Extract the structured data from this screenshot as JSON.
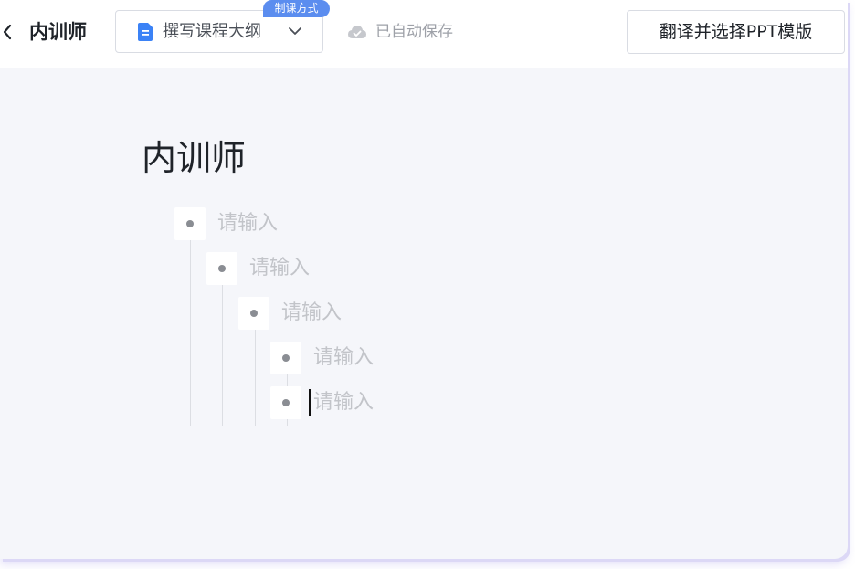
{
  "header": {
    "back_icon": "chevron-left-icon",
    "doc_name": "内训师",
    "mode_select": {
      "badge": "制课方式",
      "selected": "撰写课程大纲",
      "icon": "document-icon",
      "icon_color": "#3b82f6"
    },
    "save_status": {
      "icon": "cloud-check-icon",
      "label": "已自动保存"
    },
    "translate_button": "翻译并选择PPT模版"
  },
  "document": {
    "title": "内训师",
    "outline": [
      {
        "level": 1,
        "text": "请输入"
      },
      {
        "level": 2,
        "text": "请输入"
      },
      {
        "level": 3,
        "text": "请输入"
      },
      {
        "level": 4,
        "text": "请输入"
      },
      {
        "level": 4,
        "text": "请输入",
        "focused": true
      }
    ]
  },
  "colors": {
    "accent": "#5b8def",
    "canvas": "#f5f6fa",
    "placeholder_text": "#c2c4c9"
  }
}
